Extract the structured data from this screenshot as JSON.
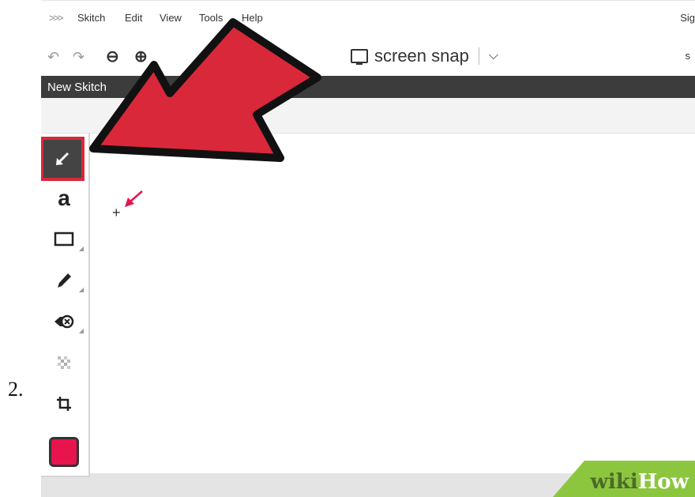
{
  "step_number": "2.",
  "menu": {
    "logo_icon": "double-chevron-icon",
    "items": [
      "Skitch",
      "Edit",
      "View",
      "Tools",
      "Help"
    ],
    "right_text": "Sig"
  },
  "toolbar": {
    "undo_icon": "undo-icon",
    "redo_icon": "redo-icon",
    "zoom_out_icon": "zoom-out-icon",
    "zoom_in_icon": "zoom-in-icon",
    "snap_label": "screen snap",
    "snap_chevron": "chevron-down-icon",
    "right_text": "s"
  },
  "document": {
    "title": "New Skitch"
  },
  "tools": [
    {
      "name": "arrow-tool",
      "icon": "arrow-icon",
      "selected": true
    },
    {
      "name": "text-tool",
      "icon": "text-icon",
      "glyph": "a"
    },
    {
      "name": "shape-tool",
      "icon": "rectangle-icon"
    },
    {
      "name": "pen-tool",
      "icon": "pen-icon"
    },
    {
      "name": "stamp-tool",
      "icon": "stamp-icon"
    },
    {
      "name": "pixelate-tool",
      "icon": "pixelate-icon"
    },
    {
      "name": "crop-tool",
      "icon": "crop-icon"
    }
  ],
  "color_swatch": "#e8144e",
  "callout_color": "#d9283a",
  "watermark": {
    "wiki": "wiki",
    "how": "How",
    "color": "#8cc63f"
  }
}
